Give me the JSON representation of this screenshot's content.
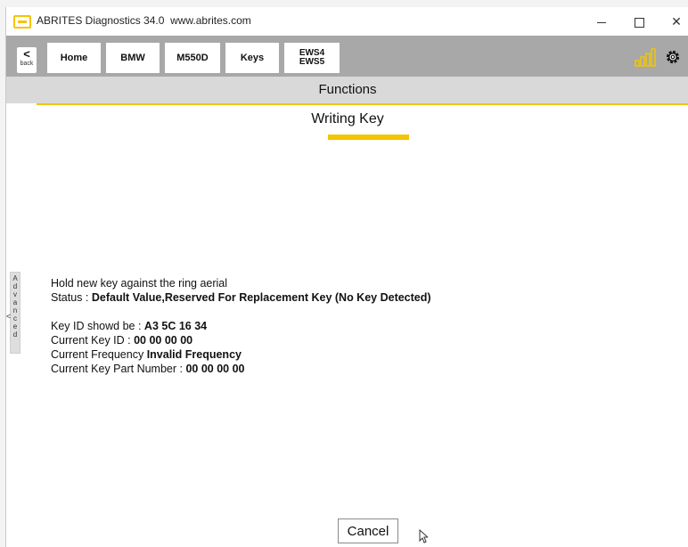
{
  "window": {
    "title": "ABRITES Diagnostics 34.0",
    "url": "www.abrites.com"
  },
  "navbar": {
    "back_label": "back",
    "breadcrumbs": [
      "Home",
      "BMW",
      "M550D",
      "Keys"
    ],
    "last_crumb": [
      "EWS4",
      "EWS5"
    ]
  },
  "functions": {
    "label": "Functions"
  },
  "page": {
    "heading": "Writing Key"
  },
  "advanced": {
    "letters": [
      "A",
      "d",
      "v",
      "a",
      "n",
      "c",
      "e",
      "d"
    ]
  },
  "info": {
    "instruction": "Hold new key against the ring aerial",
    "status_label": "Status : ",
    "status_value": "Default Value,Reserved For Replacement Key (No Key Detected)",
    "key_id_should_label": "Key ID showd be : ",
    "key_id_should_value": "A3 5C 16 34",
    "current_key_id_label": "Current Key ID : ",
    "current_key_id_value": "00 00 00 00",
    "current_freq_label": "Current Frequency ",
    "current_freq_value": "Invalid Frequency",
    "current_part_label": "Current Key Part Number : ",
    "current_part_value": "00 00 00 00"
  },
  "buttons": {
    "cancel": "Cancel"
  },
  "colors": {
    "accent": "#f2c500",
    "nav_bg": "#a8a8a8",
    "functions_bg": "#d9d9d9"
  },
  "icons": {
    "signal": "signal-strength-icon",
    "settings": "gear-icon",
    "back": "chevron-left-icon"
  }
}
